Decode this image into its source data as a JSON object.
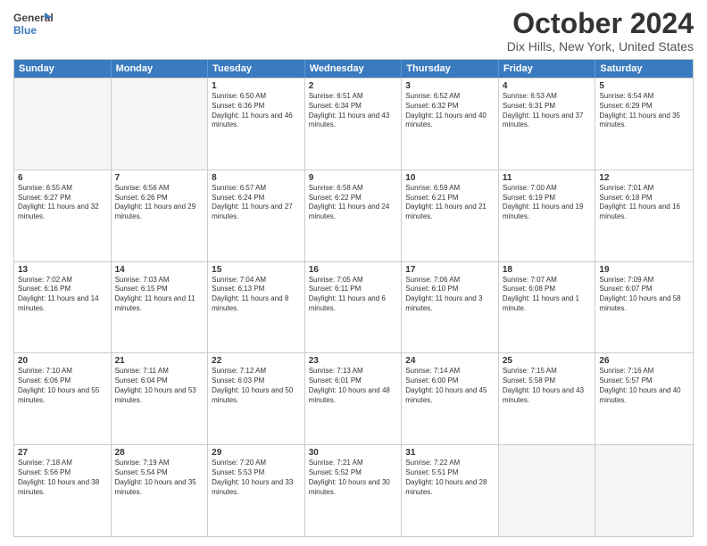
{
  "header": {
    "logo_general": "General",
    "logo_blue": "Blue",
    "month": "October 2024",
    "location": "Dix Hills, New York, United States"
  },
  "days_of_week": [
    "Sunday",
    "Monday",
    "Tuesday",
    "Wednesday",
    "Thursday",
    "Friday",
    "Saturday"
  ],
  "rows": [
    [
      {
        "day": "",
        "info": ""
      },
      {
        "day": "",
        "info": ""
      },
      {
        "day": "1",
        "info": "Sunrise: 6:50 AM\nSunset: 6:36 PM\nDaylight: 11 hours and 46 minutes."
      },
      {
        "day": "2",
        "info": "Sunrise: 6:51 AM\nSunset: 6:34 PM\nDaylight: 11 hours and 43 minutes."
      },
      {
        "day": "3",
        "info": "Sunrise: 6:52 AM\nSunset: 6:32 PM\nDaylight: 11 hours and 40 minutes."
      },
      {
        "day": "4",
        "info": "Sunrise: 6:53 AM\nSunset: 6:31 PM\nDaylight: 11 hours and 37 minutes."
      },
      {
        "day": "5",
        "info": "Sunrise: 6:54 AM\nSunset: 6:29 PM\nDaylight: 11 hours and 35 minutes."
      }
    ],
    [
      {
        "day": "6",
        "info": "Sunrise: 6:55 AM\nSunset: 6:27 PM\nDaylight: 11 hours and 32 minutes."
      },
      {
        "day": "7",
        "info": "Sunrise: 6:56 AM\nSunset: 6:26 PM\nDaylight: 11 hours and 29 minutes."
      },
      {
        "day": "8",
        "info": "Sunrise: 6:57 AM\nSunset: 6:24 PM\nDaylight: 11 hours and 27 minutes."
      },
      {
        "day": "9",
        "info": "Sunrise: 6:58 AM\nSunset: 6:22 PM\nDaylight: 11 hours and 24 minutes."
      },
      {
        "day": "10",
        "info": "Sunrise: 6:59 AM\nSunset: 6:21 PM\nDaylight: 11 hours and 21 minutes."
      },
      {
        "day": "11",
        "info": "Sunrise: 7:00 AM\nSunset: 6:19 PM\nDaylight: 11 hours and 19 minutes."
      },
      {
        "day": "12",
        "info": "Sunrise: 7:01 AM\nSunset: 6:18 PM\nDaylight: 11 hours and 16 minutes."
      }
    ],
    [
      {
        "day": "13",
        "info": "Sunrise: 7:02 AM\nSunset: 6:16 PM\nDaylight: 11 hours and 14 minutes."
      },
      {
        "day": "14",
        "info": "Sunrise: 7:03 AM\nSunset: 6:15 PM\nDaylight: 11 hours and 11 minutes."
      },
      {
        "day": "15",
        "info": "Sunrise: 7:04 AM\nSunset: 6:13 PM\nDaylight: 11 hours and 8 minutes."
      },
      {
        "day": "16",
        "info": "Sunrise: 7:05 AM\nSunset: 6:11 PM\nDaylight: 11 hours and 6 minutes."
      },
      {
        "day": "17",
        "info": "Sunrise: 7:06 AM\nSunset: 6:10 PM\nDaylight: 11 hours and 3 minutes."
      },
      {
        "day": "18",
        "info": "Sunrise: 7:07 AM\nSunset: 6:08 PM\nDaylight: 11 hours and 1 minute."
      },
      {
        "day": "19",
        "info": "Sunrise: 7:09 AM\nSunset: 6:07 PM\nDaylight: 10 hours and 58 minutes."
      }
    ],
    [
      {
        "day": "20",
        "info": "Sunrise: 7:10 AM\nSunset: 6:06 PM\nDaylight: 10 hours and 55 minutes."
      },
      {
        "day": "21",
        "info": "Sunrise: 7:11 AM\nSunset: 6:04 PM\nDaylight: 10 hours and 53 minutes."
      },
      {
        "day": "22",
        "info": "Sunrise: 7:12 AM\nSunset: 6:03 PM\nDaylight: 10 hours and 50 minutes."
      },
      {
        "day": "23",
        "info": "Sunrise: 7:13 AM\nSunset: 6:01 PM\nDaylight: 10 hours and 48 minutes."
      },
      {
        "day": "24",
        "info": "Sunrise: 7:14 AM\nSunset: 6:00 PM\nDaylight: 10 hours and 45 minutes."
      },
      {
        "day": "25",
        "info": "Sunrise: 7:15 AM\nSunset: 5:58 PM\nDaylight: 10 hours and 43 minutes."
      },
      {
        "day": "26",
        "info": "Sunrise: 7:16 AM\nSunset: 5:57 PM\nDaylight: 10 hours and 40 minutes."
      }
    ],
    [
      {
        "day": "27",
        "info": "Sunrise: 7:18 AM\nSunset: 5:56 PM\nDaylight: 10 hours and 38 minutes."
      },
      {
        "day": "28",
        "info": "Sunrise: 7:19 AM\nSunset: 5:54 PM\nDaylight: 10 hours and 35 minutes."
      },
      {
        "day": "29",
        "info": "Sunrise: 7:20 AM\nSunset: 5:53 PM\nDaylight: 10 hours and 33 minutes."
      },
      {
        "day": "30",
        "info": "Sunrise: 7:21 AM\nSunset: 5:52 PM\nDaylight: 10 hours and 30 minutes."
      },
      {
        "day": "31",
        "info": "Sunrise: 7:22 AM\nSunset: 5:51 PM\nDaylight: 10 hours and 28 minutes."
      },
      {
        "day": "",
        "info": ""
      },
      {
        "day": "",
        "info": ""
      }
    ]
  ]
}
